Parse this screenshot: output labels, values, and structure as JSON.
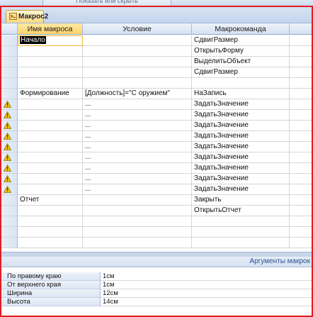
{
  "ribbon": {
    "command_label": "Показать или скрыть"
  },
  "document_tab": {
    "title": "Макрос2",
    "icon": "macro-icon"
  },
  "grid": {
    "columns": [
      "Имя макроса",
      "Условие",
      "Макрокоманда"
    ],
    "rows": [
      {
        "name": "Начало",
        "condition": "",
        "action": "СдвигРазмер",
        "warning": false,
        "active": true
      },
      {
        "name": "",
        "condition": "",
        "action": "ОткрытьФорму",
        "warning": false,
        "active": false
      },
      {
        "name": "",
        "condition": "",
        "action": "ВыделитьОбъект",
        "warning": false,
        "active": false
      },
      {
        "name": "",
        "condition": "",
        "action": "СдвигРазмер",
        "warning": false,
        "active": false
      },
      {
        "name": "",
        "condition": "",
        "action": "",
        "warning": false,
        "active": false
      },
      {
        "name": "Формирование",
        "condition": "[Должность]=\"С оружием\"",
        "action": "НаЗапись",
        "warning": false,
        "active": false
      },
      {
        "name": "",
        "condition": "...",
        "action": "ЗадатьЗначение",
        "warning": true,
        "active": false
      },
      {
        "name": "",
        "condition": "...",
        "action": "ЗадатьЗначение",
        "warning": true,
        "active": false
      },
      {
        "name": "",
        "condition": "...",
        "action": "ЗадатьЗначение",
        "warning": true,
        "active": false
      },
      {
        "name": "",
        "condition": "...",
        "action": "ЗадатьЗначение",
        "warning": true,
        "active": false
      },
      {
        "name": "",
        "condition": "...",
        "action": "ЗадатьЗначение",
        "warning": true,
        "active": false
      },
      {
        "name": "",
        "condition": "...",
        "action": "ЗадатьЗначение",
        "warning": true,
        "active": false
      },
      {
        "name": "",
        "condition": "...",
        "action": "ЗадатьЗначение",
        "warning": true,
        "active": false
      },
      {
        "name": "",
        "condition": "...",
        "action": "ЗадатьЗначение",
        "warning": true,
        "active": false
      },
      {
        "name": "",
        "condition": "...",
        "action": "ЗадатьЗначение",
        "warning": true,
        "active": false
      },
      {
        "name": "Отчет",
        "condition": "",
        "action": "Закрыть",
        "warning": false,
        "active": false
      },
      {
        "name": "",
        "condition": "",
        "action": "ОткрытьОтчет",
        "warning": false,
        "active": false
      },
      {
        "name": "",
        "condition": "",
        "action": "",
        "warning": false,
        "active": false
      },
      {
        "name": "",
        "condition": "",
        "action": "",
        "warning": false,
        "active": false
      },
      {
        "name": "",
        "condition": "",
        "action": "",
        "warning": false,
        "active": false
      }
    ]
  },
  "arguments_pane": {
    "title": "Аргументы макрок",
    "rows": [
      {
        "label": "По правому краю",
        "value": "1см"
      },
      {
        "label": "От верхнего края",
        "value": "1см"
      },
      {
        "label": "Ширина",
        "value": "12см"
      },
      {
        "label": "Высота",
        "value": "14см"
      }
    ]
  },
  "colors": {
    "frame_border": "#e21c24",
    "header_bg": "#d5e1f1",
    "selected_header_bg": "#fbd36a",
    "warning_icon": "#f2c200"
  }
}
